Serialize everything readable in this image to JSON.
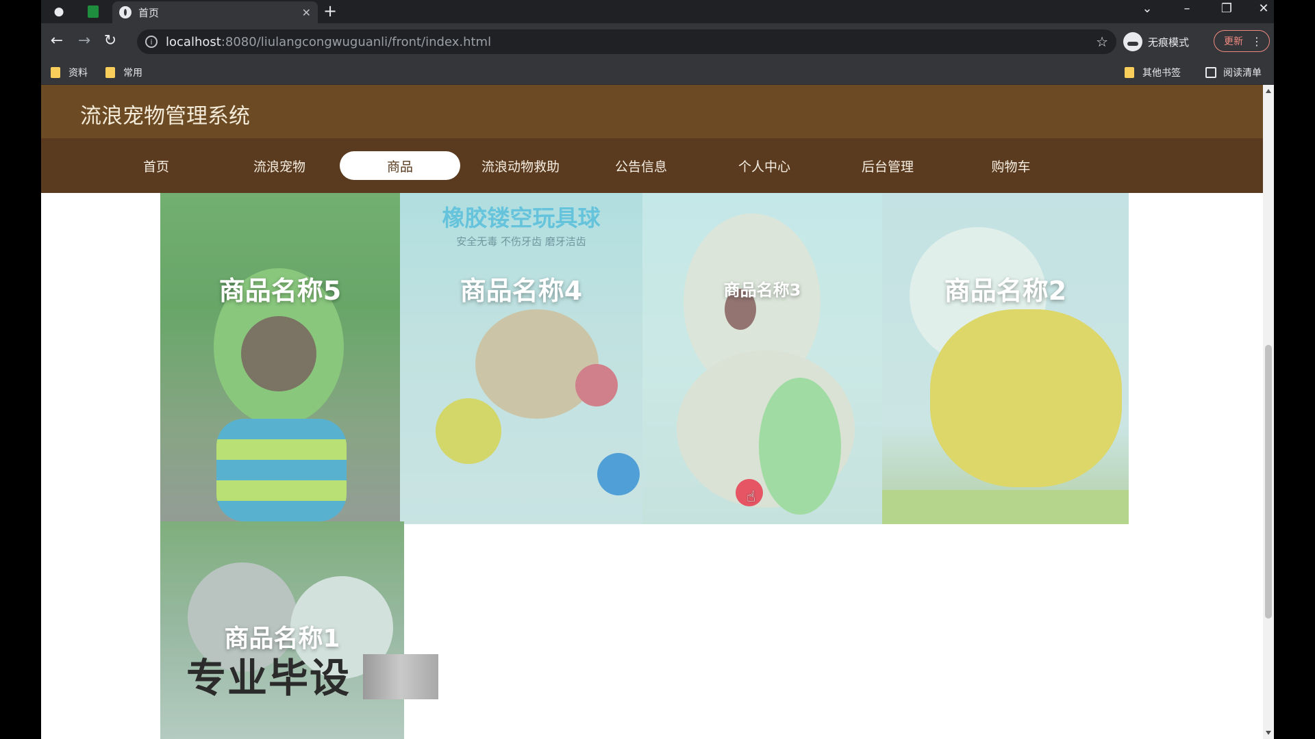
{
  "browser": {
    "tab_title": "首页",
    "new_tab_symbol": "+",
    "url_host": "localhost",
    "url_path": ":8080/liulangcongwuguanli/front/index.html",
    "incognito_label": "无痕模式",
    "update_label": "更新",
    "bookmarks": [
      "资料",
      "常用"
    ],
    "bookmarks_right": [
      "其他书签",
      "阅读清单"
    ]
  },
  "site": {
    "title": "流浪宠物管理系统",
    "nav": [
      {
        "label": "首页",
        "active": false
      },
      {
        "label": "流浪宠物",
        "active": false
      },
      {
        "label": "商品",
        "active": true
      },
      {
        "label": "流浪动物救助",
        "active": false
      },
      {
        "label": "公告信息",
        "active": false
      },
      {
        "label": "个人中心",
        "active": false
      },
      {
        "label": "后台管理",
        "active": false
      },
      {
        "label": "购物车",
        "active": false
      }
    ]
  },
  "products": [
    {
      "name": "商品名称5"
    },
    {
      "name": "商品名称4",
      "banner_title": "橡胶镂空玩具球",
      "banner_sub": "安全无毒  不伤牙齿  磨牙洁齿"
    },
    {
      "name": "商品名称3"
    },
    {
      "name": "商品名称2"
    },
    {
      "name": "商品名称1"
    }
  ],
  "watermark": "专业毕设",
  "colors": {
    "header_bg": "#6b4a24",
    "nav_bg": "#5a3b1f",
    "active_nav_bg": "#ffffff"
  },
  "icons": [
    "globe-icon",
    "sheets-icon",
    "close-icon",
    "back-icon",
    "forward-icon",
    "reload-icon",
    "info-icon",
    "star-icon",
    "incognito-icon",
    "menu-dots-icon",
    "folder-icon",
    "reading-list-icon"
  ]
}
